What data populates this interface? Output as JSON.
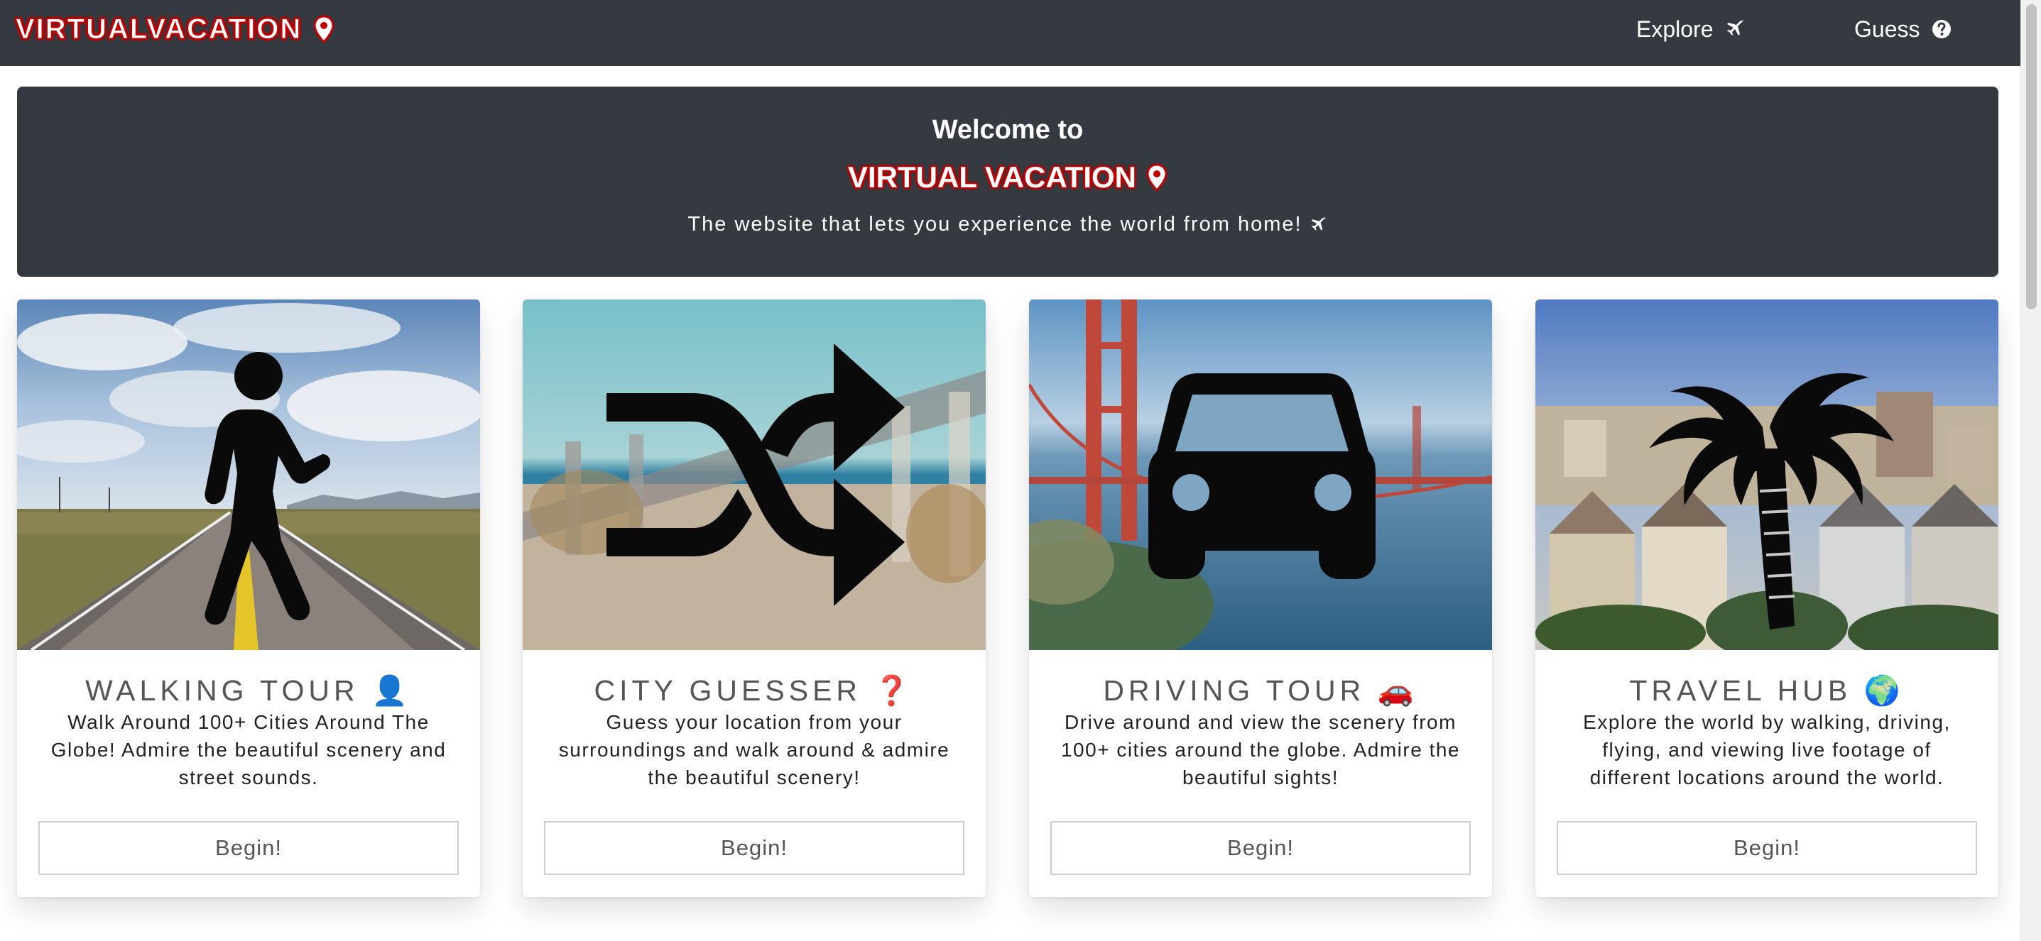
{
  "navbar": {
    "brand": "VIRTUALVACATION",
    "links": [
      {
        "label": "Explore",
        "icon": "plane-icon"
      },
      {
        "label": "Guess",
        "icon": "question-circle-icon"
      }
    ]
  },
  "hero": {
    "welcome": "Welcome to",
    "brand": "VIRTUAL VACATION",
    "tagline": "The website that lets you experience the world from home!"
  },
  "cards": [
    {
      "title": "WALKING TOUR 👤",
      "description": "Walk Around 100+ Cities Around The Globe! Admire the beautiful scenery and street sounds.",
      "button": "Begin!",
      "icon": "walking-person-icon"
    },
    {
      "title": "CITY GUESSER ❓",
      "description": "Guess your location from your surroundings and walk around & admire the beautiful scenery!",
      "button": "Begin!",
      "icon": "shuffle-icon"
    },
    {
      "title": "DRIVING TOUR 🚗",
      "description": "Drive around and view the scenery from 100+ cities around the globe. Admire the beautiful sights!",
      "button": "Begin!",
      "icon": "car-icon"
    },
    {
      "title": "TRAVEL HUB 🌍",
      "description": "Explore the world by walking, driving, flying, and viewing live footage of different locations around the world.",
      "button": "Begin!",
      "icon": "palm-tree-icon"
    }
  ],
  "colors": {
    "navbar_bg": "#343a40",
    "brand_outline": "#c00000",
    "card_title": "#555555"
  }
}
